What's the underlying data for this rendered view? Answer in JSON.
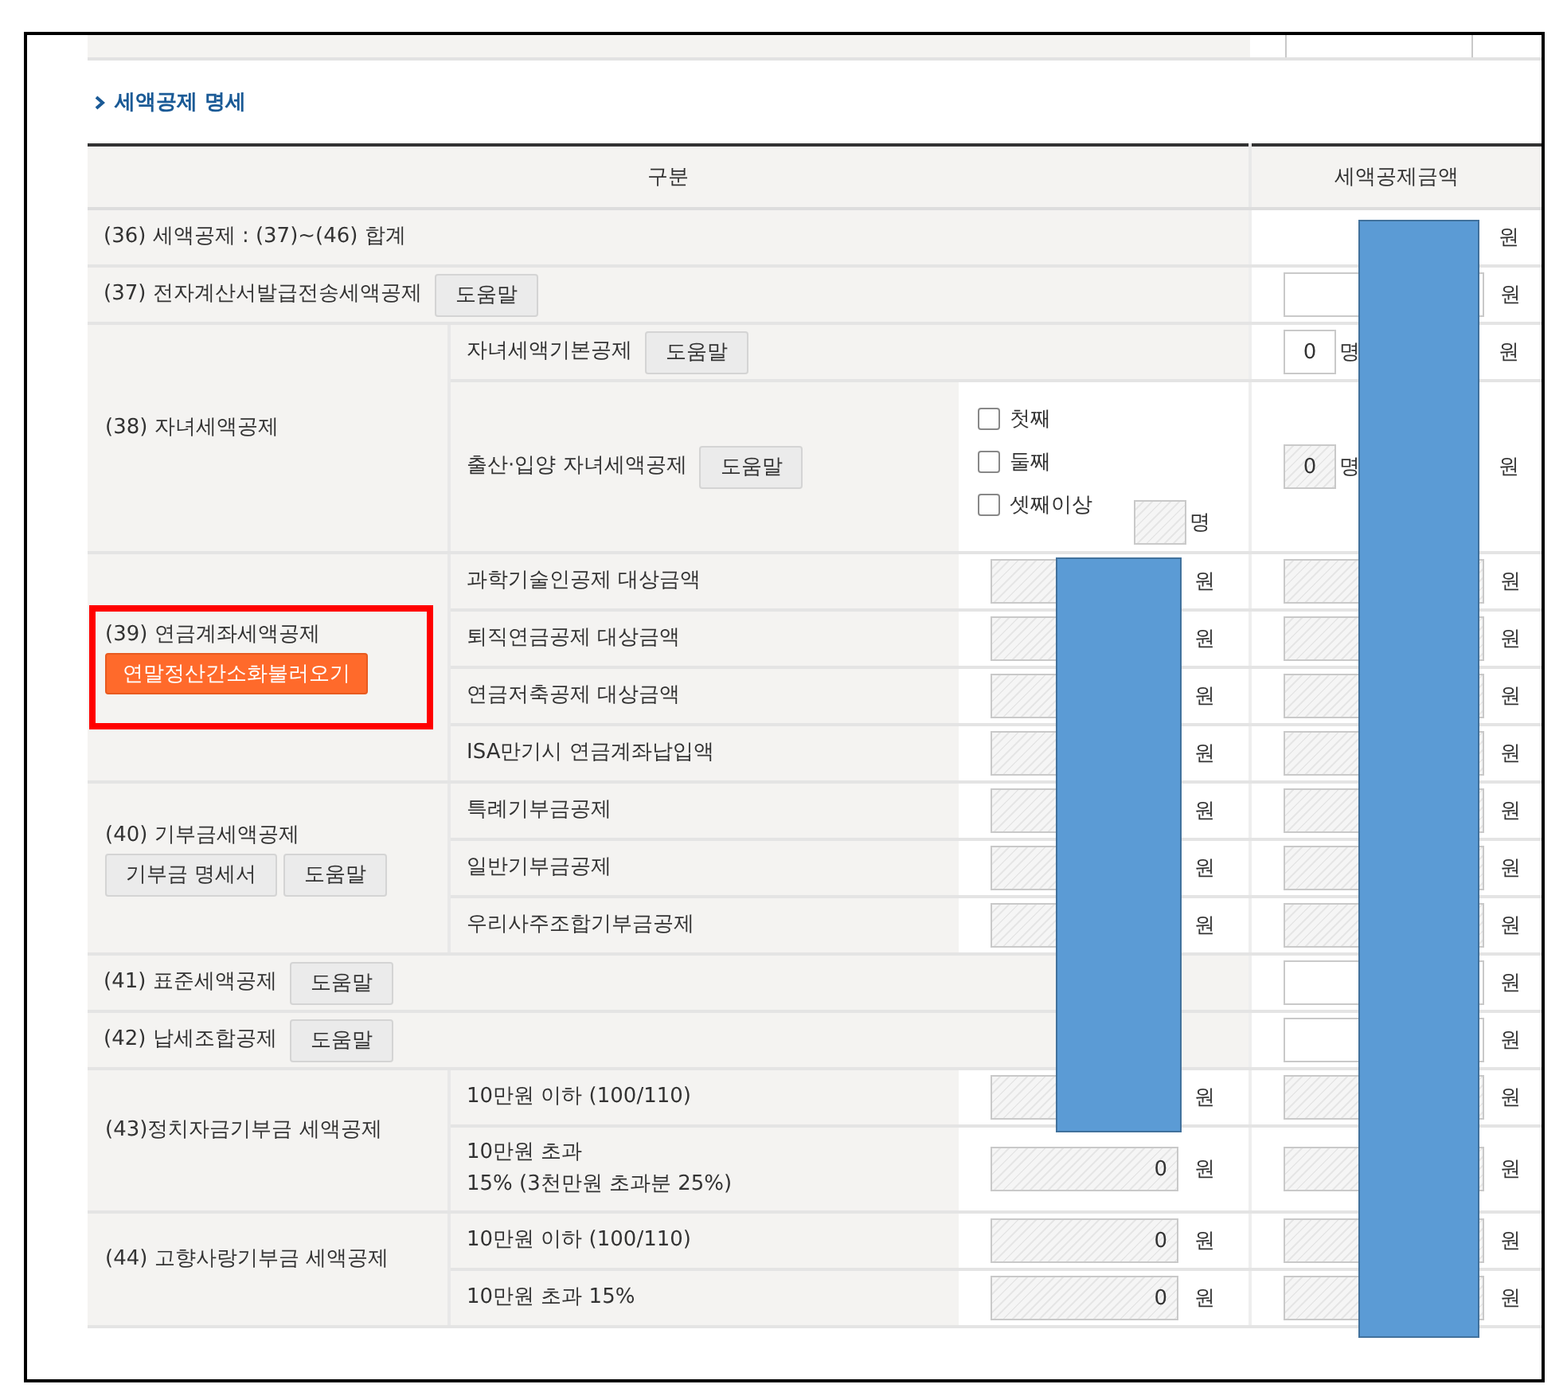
{
  "top_row": {
    "field": {
      "disabled": false
    }
  },
  "section_title": "세액공제 명세",
  "columns": [
    "구분",
    "세액공제금액"
  ],
  "groups": [
    {
      "label": "(36) 세액공제 : (37)~(46) 합계",
      "highlighted": false,
      "amount": {
        "unit": "원"
      }
    },
    {
      "label": "(37) 전자계산서발급전송세액공제",
      "highlighted": false,
      "buttons": [
        {
          "label": "도움말",
          "kind": "plain"
        }
      ],
      "amount": {
        "field": {
          "disabled": false
        },
        "unit": "원"
      }
    },
    {
      "label": "(38) 자녀세액공제",
      "highlighted": false,
      "subrows": [
        {
          "label": "자녀세액기본공제",
          "button": {
            "label": "도움말",
            "kind": "plain"
          },
          "amount": {
            "count": {
              "value": "0",
              "unit": "명",
              "disabled": false
            },
            "unit": "원"
          }
        },
        {
          "label": "출산·입양 자녀세액공제",
          "button": {
            "label": "도움말",
            "kind": "plain"
          },
          "detail": {
            "checks": [
              {
                "label": "첫째",
                "checked": false
              },
              {
                "label": "둘째",
                "checked": false
              },
              {
                "label": "셋째이상",
                "checked": false
              }
            ],
            "count": {
              "disabled": true,
              "unit": "명"
            }
          },
          "amount": {
            "count": {
              "value": "0",
              "unit": "명",
              "disabled": true
            },
            "unit": "원"
          }
        }
      ]
    },
    {
      "label": "(39) 연금계좌세액공제",
      "highlighted": true,
      "buttons": [
        {
          "label": "연말정산간소화불러오기",
          "kind": "primary"
        }
      ],
      "subrows": [
        {
          "label": "과학기술인공제 대상금액",
          "detail": {
            "field": {
              "disabled": true
            },
            "unit": "원"
          },
          "amount": {
            "field": {
              "disabled": true
            },
            "unit": "원"
          }
        },
        {
          "label": "퇴직연금공제 대상금액",
          "detail": {
            "field": {
              "disabled": true
            },
            "unit": "원"
          },
          "amount": {
            "field": {
              "disabled": true
            },
            "unit": "원"
          }
        },
        {
          "label": "연금저축공제 대상금액",
          "detail": {
            "field": {
              "disabled": true
            },
            "unit": "원"
          },
          "amount": {
            "field": {
              "disabled": true
            },
            "unit": "원"
          }
        },
        {
          "label": "ISA만기시 연금계좌납입액",
          "detail": {
            "field": {
              "disabled": true
            },
            "unit": "원"
          },
          "amount": {
            "field": {
              "disabled": true
            },
            "unit": "원"
          }
        }
      ]
    },
    {
      "label": "(40) 기부금세액공제",
      "highlighted": false,
      "buttons": [
        {
          "label": "기부금 명세서",
          "kind": "plain"
        },
        {
          "label": "도움말",
          "kind": "plain"
        }
      ],
      "subrows": [
        {
          "label": "특례기부금공제",
          "detail": {
            "field": {
              "disabled": true
            },
            "unit": "원"
          },
          "amount": {
            "field": {
              "disabled": true
            },
            "unit": "원"
          }
        },
        {
          "label": "일반기부금공제",
          "detail": {
            "field": {
              "disabled": true
            },
            "unit": "원"
          },
          "amount": {
            "field": {
              "disabled": true
            },
            "unit": "원"
          }
        },
        {
          "label": "우리사주조합기부금공제",
          "detail": {
            "field": {
              "disabled": true
            },
            "unit": "원"
          },
          "amount": {
            "field": {
              "disabled": true
            },
            "unit": "원"
          }
        }
      ]
    },
    {
      "label": "(41) 표준세액공제",
      "highlighted": false,
      "buttons": [
        {
          "label": "도움말",
          "kind": "plain"
        }
      ],
      "amount": {
        "field": {
          "disabled": false
        },
        "unit": "원"
      }
    },
    {
      "label": "(42) 납세조합공제",
      "highlighted": false,
      "buttons": [
        {
          "label": "도움말",
          "kind": "plain"
        }
      ],
      "amount": {
        "field": {
          "disabled": false
        },
        "unit": "원"
      }
    },
    {
      "label": "(43)정치자금기부금 세액공제",
      "highlighted": false,
      "subrows": [
        {
          "label": "10만원 이하 (100/110)",
          "detail": {
            "field": {
              "disabled": true
            },
            "unit": "원"
          },
          "amount": {
            "field": {
              "disabled": true
            },
            "unit": "원"
          }
        },
        {
          "label": "10만원 초과\n15% (3천만원 초과분 25%)",
          "detail": {
            "field": {
              "value": "0",
              "disabled": true
            },
            "unit": "원"
          },
          "amount": {
            "field": {
              "disabled": true
            },
            "unit": "원"
          }
        }
      ]
    },
    {
      "label": "(44) 고향사랑기부금 세액공제",
      "highlighted": false,
      "subrows": [
        {
          "label": "10만원 이하 (100/110)",
          "detail": {
            "field": {
              "value": "0",
              "disabled": true
            },
            "unit": "원"
          },
          "amount": {
            "field": {
              "disabled": true
            },
            "unit": "원"
          }
        },
        {
          "label": "10만원 초과 15%",
          "detail": {
            "field": {
              "value": "0",
              "disabled": true
            },
            "unit": "원"
          },
          "amount": {
            "field": {
              "disabled": true
            },
            "unit": "원"
          }
        }
      ]
    }
  ],
  "redactions": {
    "amount_column": true,
    "detail_column": true
  }
}
